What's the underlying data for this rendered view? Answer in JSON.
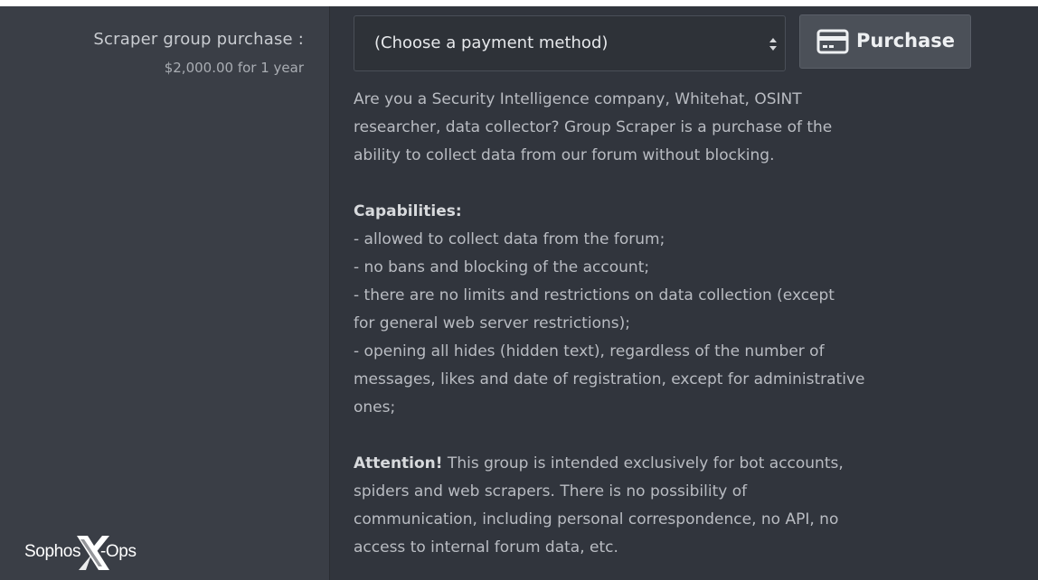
{
  "field": {
    "label": "Scraper group purchase :",
    "hint": "$2,000.00 for 1 year"
  },
  "payment_select": {
    "selected": "(Choose a payment method)"
  },
  "purchase_button": {
    "label": "Purchase",
    "icon": "credit-card-icon"
  },
  "description": {
    "intro_lines": [
      "Are you a Security Intelligence company, Whitehat, OSINT",
      "researcher, data collector? Group Scraper is a purchase of the",
      "ability to collect data from our forum without blocking."
    ],
    "capabilities_heading": "Capabilities:",
    "capability_lines": [
      "- allowed to collect data from the forum;",
      "- no bans and blocking of the account;",
      "- there are no limits and restrictions on data collection (except",
      "for general web server restrictions);",
      "- opening all hides (hidden text), regardless of the number of",
      "messages, likes and date of registration, except for administrative",
      "ones;"
    ],
    "attention_label": "Attention!",
    "attention_first": " This group is intended exclusively for bot accounts,",
    "attention_lines": [
      "spiders and web scrapers. There is no possibility of",
      "communication, including personal correspondence, no API, no",
      "access to internal forum data, etc."
    ]
  },
  "watermark": {
    "part1": "Sophos",
    "part2": "-Ops",
    "colors": {
      "text": "#ffffff",
      "accent": "#ffffff"
    }
  },
  "colors": {
    "background": "#31353d",
    "label_column": "#3a3e46",
    "button": "#4b5058",
    "text": "#b9bcc2"
  }
}
